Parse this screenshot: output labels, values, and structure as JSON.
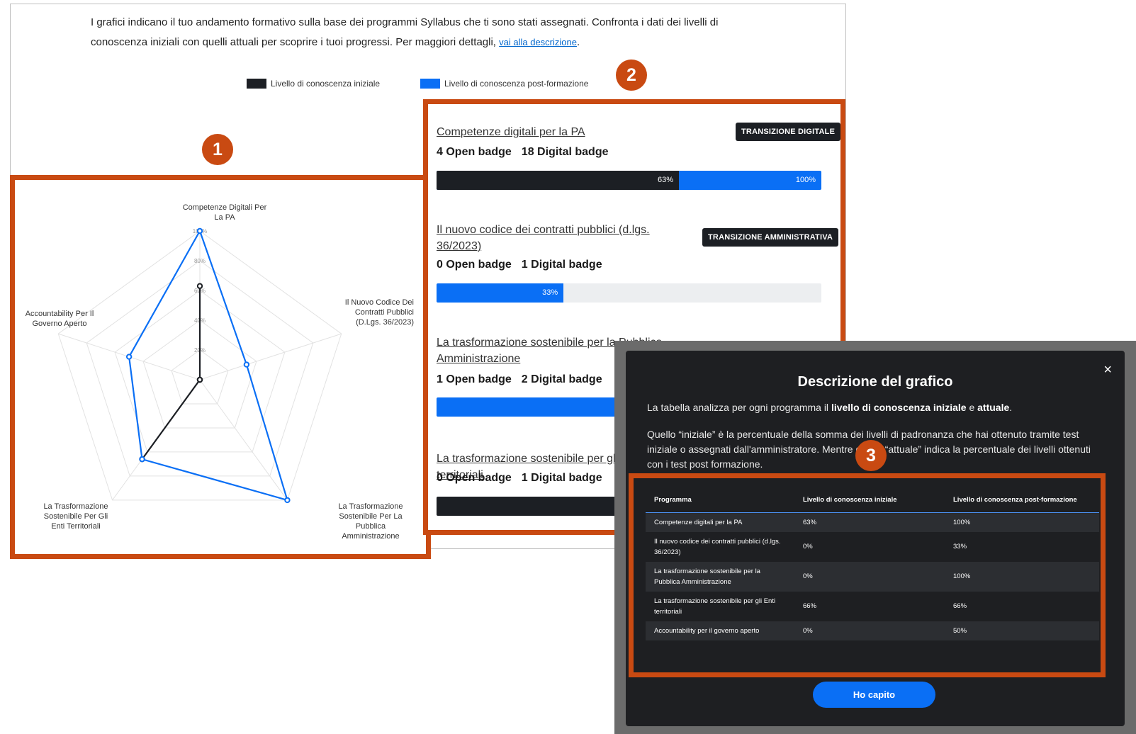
{
  "intro": {
    "text": "I grafici indicano il tuo andamento formativo sulla base dei programmi Syllabus che ti sono stati assegnati. Confronta i dati dei livelli di conoscenza iniziali con quelli attuali per scoprire i tuoi progressi. Per maggiori dettagli,",
    "link": "vai alla descrizione"
  },
  "legend": {
    "initial": "Livello di conoscenza iniziale",
    "post": "Livello di conoscenza post-formazione"
  },
  "colors": {
    "initial": "#1c1f24",
    "post": "#0a6ff5",
    "annotation": "#c94a12"
  },
  "annotations": [
    "1",
    "2",
    "3"
  ],
  "chart_data": {
    "type": "radar",
    "axes": [
      "Competenze Digitali Per La PA",
      "Il Nuovo Codice Dei Contratti Pubblici (D.Lgs. 36/2023)",
      "La Trasformazione Sostenibile Per La Pubblica Amministrazione",
      "La Trasformazione Sostenibile Per Gli Enti Territoriali",
      "Accountability Per Il Governo Aperto"
    ],
    "ticks": [
      "20%",
      "40%",
      "60%",
      "80%",
      "100%"
    ],
    "series": [
      {
        "name": "Livello di conoscenza iniziale",
        "values": [
          63,
          0,
          0,
          66,
          0
        ]
      },
      {
        "name": "Livello di conoscenza post-formazione",
        "values": [
          100,
          33,
          100,
          66,
          50
        ]
      }
    ],
    "rmax": 100
  },
  "programs": [
    {
      "title": "Competenze digitali per la PA",
      "open": "4 Open badge",
      "digital": "18 Digital badge",
      "tag": "TRANSIZIONE DIGITALE",
      "initial": 63,
      "post": 100,
      "initial_label": "63%",
      "post_label": "100%"
    },
    {
      "title": "Il nuovo codice dei contratti pubblici (d.lgs. 36/2023)",
      "open": "0 Open badge",
      "digital": "1 Digital badge",
      "tag": "TRANSIZIONE AMMINISTRATIVA",
      "initial": 0,
      "post": 33,
      "initial_label": "",
      "post_label": "33%"
    },
    {
      "title": "La trasformazione sostenibile per la Pubblica Amministrazione",
      "open": "1 Open badge",
      "digital": "2 Digital badge",
      "tag": "",
      "initial": 0,
      "post": 100,
      "initial_label": "",
      "post_label": ""
    },
    {
      "title": "La trasformazione sostenibile per gli Enti territoriali",
      "open": "0 Open badge",
      "digital": "1 Digital badge",
      "tag": "",
      "initial": 66,
      "post": 66,
      "initial_label": "",
      "post_label": ""
    }
  ],
  "modal": {
    "title": "Descrizione del grafico",
    "close": "×",
    "p1_a": "La tabella analizza per ogni programma il",
    "p1_b": "livello di conoscenza iniziale",
    "p1_c": "e",
    "p1_d": "attuale",
    "p2": "Quello “iniziale” è la percentuale della somma dei livelli di padronanza che hai ottenuto tramite test iniziale o assegnati dall'amministratore. Mentre quello “attuale” indica la percentuale dei livelli ottenuti con i test post formazione.",
    "headers": [
      "Programma",
      "Livello di conoscenza iniziale",
      "Livello di conoscenza post-formazione"
    ],
    "rows": [
      [
        "Competenze digitali per la PA",
        "63%",
        "100%"
      ],
      [
        "Il nuovo codice dei contratti pubblici (d.lgs. 36/2023)",
        "0%",
        "33%"
      ],
      [
        "La trasformazione sostenibile per la Pubblica Amministrazione",
        "0%",
        "100%"
      ],
      [
        "La trasformazione sostenibile per gli Enti territoriali",
        "66%",
        "66%"
      ],
      [
        "Accountability per il governo aperto",
        "0%",
        "50%"
      ]
    ],
    "button": "Ho capito"
  }
}
